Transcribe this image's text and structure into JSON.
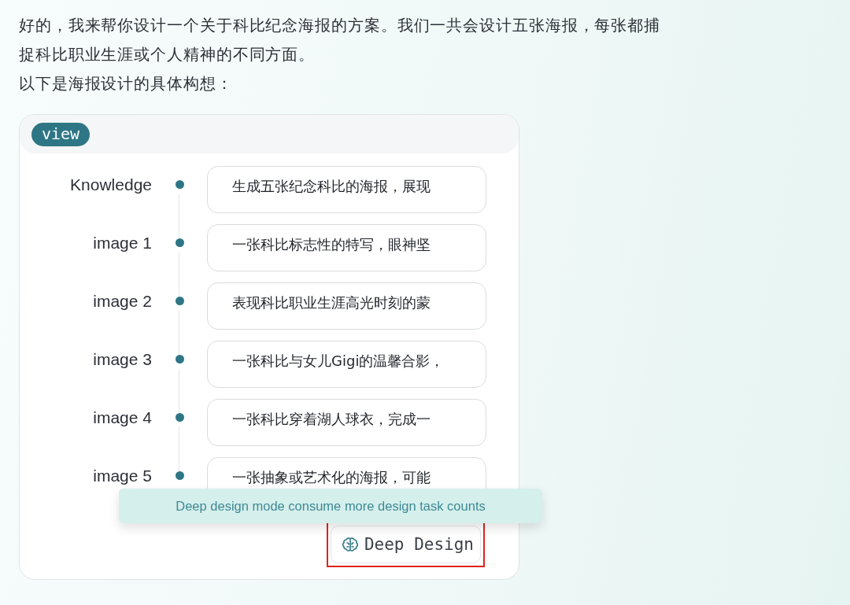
{
  "message": {
    "paragraphs": [
      "好的，我来帮你设计一个关于科比纪念海报的方案。我们一共会设计五张海报，每张都捕捉科比职业生涯或个人精神的不同方面。",
      "以下是海报设计的具体构想："
    ]
  },
  "card": {
    "tag": "view",
    "rows": [
      {
        "label": "Knowledge",
        "value": "生成五张纪念科比的海报，展现"
      },
      {
        "label": "image 1",
        "value": "一张科比标志性的特写，眼神坚"
      },
      {
        "label": "image 2",
        "value": "表现科比职业生涯高光时刻的蒙"
      },
      {
        "label": "image 3",
        "value": "一张科比与女儿Gigi的温馨合影，"
      },
      {
        "label": "image 4",
        "value": "一张科比穿着湖人球衣，完成一"
      },
      {
        "label": "image 5",
        "value": "一张抽象或艺术化的海报，可能"
      }
    ],
    "tooltip": "Deep design mode consume more design task counts",
    "button": {
      "label": "Deep Design",
      "highlighted": true
    }
  }
}
